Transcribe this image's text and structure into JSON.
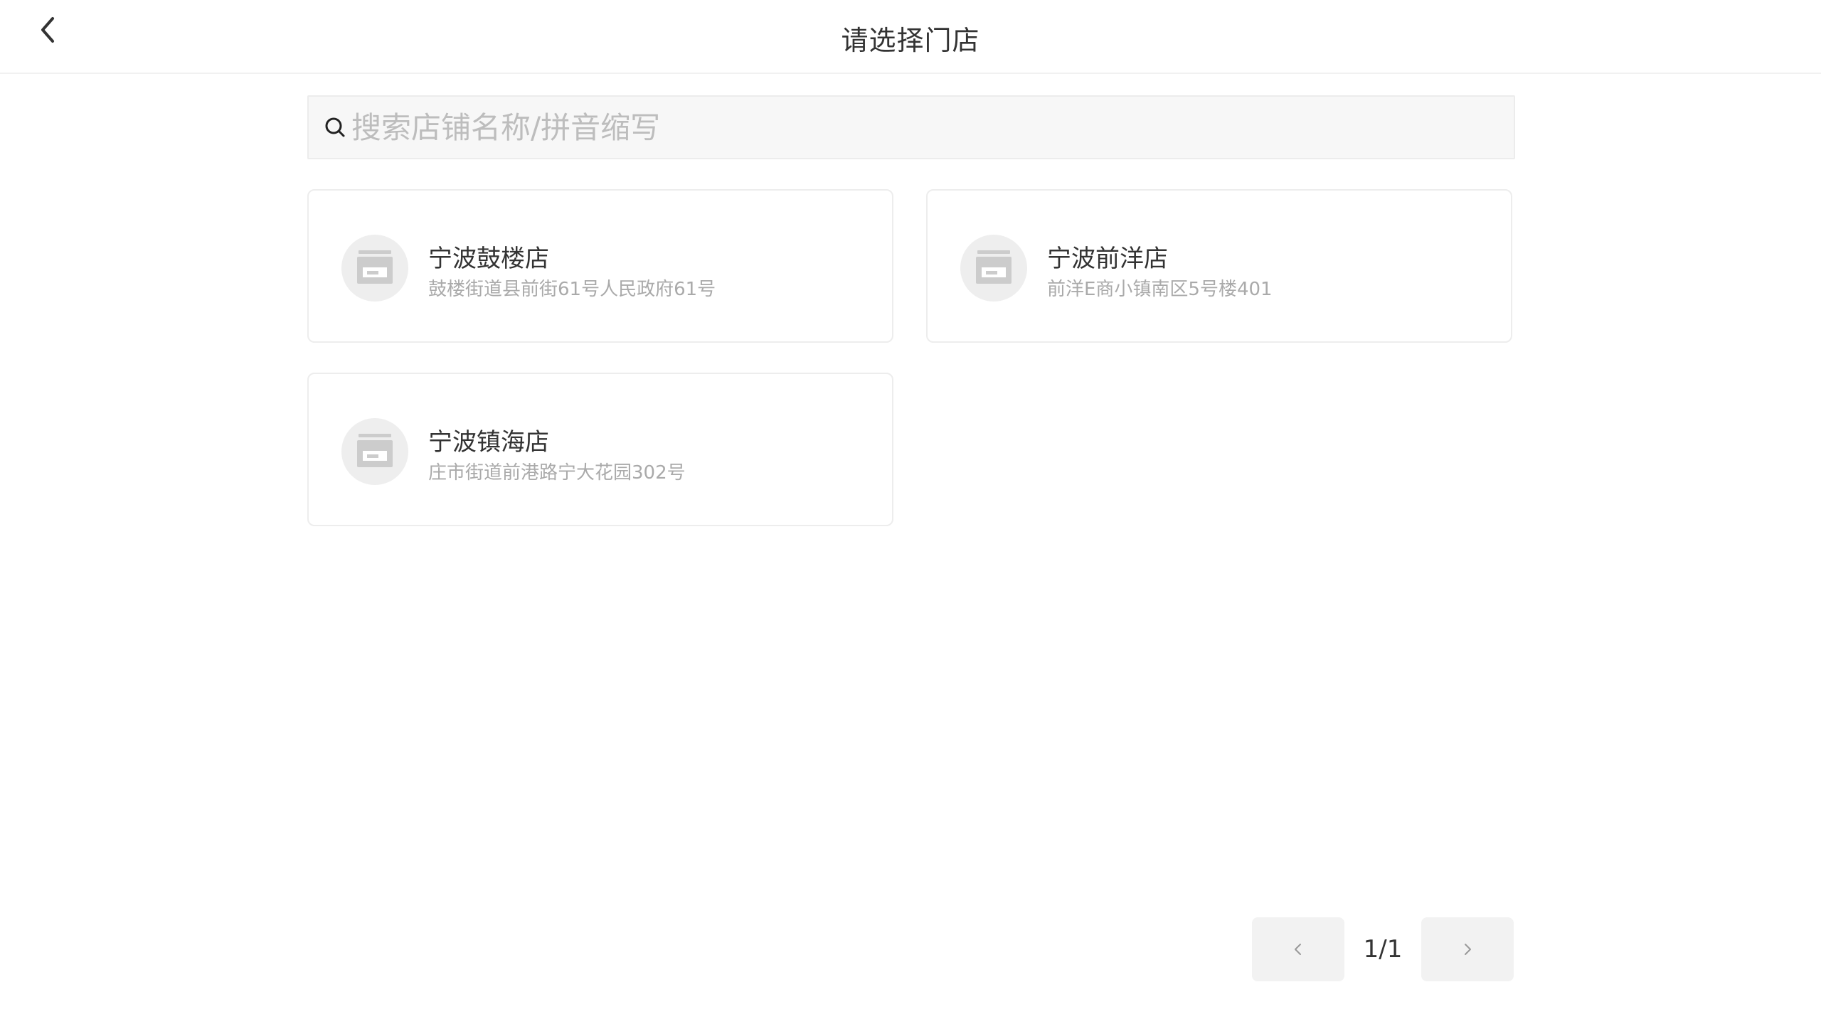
{
  "header": {
    "title": "请选择门店",
    "back_icon": "chevron-left-icon"
  },
  "search": {
    "placeholder": "搜索店铺名称/拼音缩写",
    "value": "",
    "icon": "search-icon"
  },
  "stores": [
    {
      "name": "宁波鼓楼店",
      "address": "鼓楼街道县前街61号人民政府61号",
      "icon": "store-icon"
    },
    {
      "name": "宁波前洋店",
      "address": "前洋E商小镇南区5号楼401",
      "icon": "store-icon"
    },
    {
      "name": "宁波镇海店",
      "address": "庄市街道前港路宁大花园302号",
      "icon": "store-icon"
    }
  ],
  "pagination": {
    "label": "1/1",
    "prev_icon": "chevron-left-icon",
    "next_icon": "chevron-right-icon"
  },
  "colors": {
    "background": "#ffffff",
    "card_border": "#ededed",
    "search_bg": "#f7f7f7",
    "icon_circle": "#eeeeee",
    "primary_text": "#333333",
    "secondary_text": "#aaaaaa",
    "placeholder_text": "#bdbdbd",
    "pager_button_bg": "#f2f2f2"
  }
}
